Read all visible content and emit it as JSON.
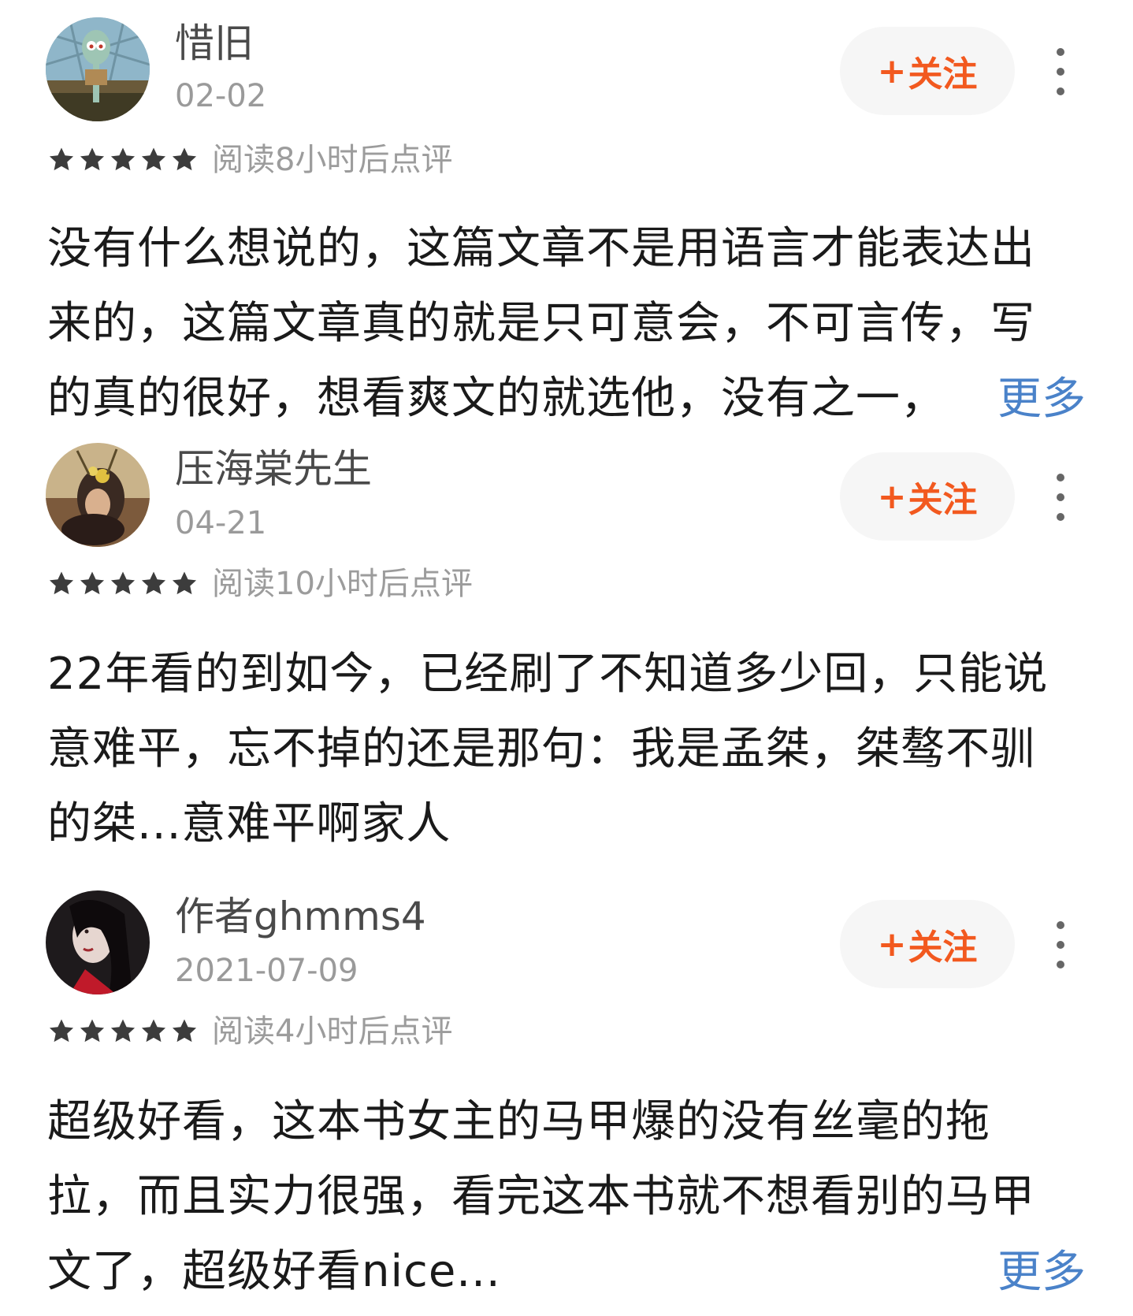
{
  "comments": [
    {
      "username": "惜旧",
      "date": "02-02",
      "follow_label": "关注",
      "follow_plus": "+",
      "read_meta": "阅读8小时后点评",
      "rating": 5,
      "lines": [
        "没有什么想说的，这篇文章不是用语言才能表达出",
        "来的，这篇文章真的就是只可意会，不可言传，写",
        "的真的很好，想看爽文的就选他，没有之一，"
      ],
      "more_label": "更多",
      "avatar": "squidward-cartoon"
    },
    {
      "username": "压海棠先生",
      "date": "04-21",
      "follow_label": "关注",
      "follow_plus": "+",
      "read_meta": "阅读10小时后点评",
      "rating": 5,
      "lines": [
        "22年看的到如今，已经刷了不知道多少回，只能说",
        "意难平，忘不掉的还是那句：我是孟桀，桀骜不驯",
        "的桀...意难平啊家人"
      ],
      "avatar": "woman-with-flowers"
    },
    {
      "username": "作者ghmms4",
      "date": "2021-07-09",
      "follow_label": "关注",
      "follow_plus": "+",
      "read_meta": "阅读4小时后点评",
      "rating": 5,
      "lines": [
        "超级好看，这本书女主的马甲爆的没有丝毫的拖",
        "拉，而且实力很强，看完这本书就不想看别的马甲",
        "文了，超级好看nice..."
      ],
      "more_label": "更多",
      "avatar": "woman-portrait-dark"
    }
  ],
  "colors": {
    "follow_text": "#f2591f",
    "follow_bg": "#f6f6f6",
    "more_link": "#4a82c9",
    "star": "#3c3c3c",
    "meta_text": "#9c9c9c"
  }
}
